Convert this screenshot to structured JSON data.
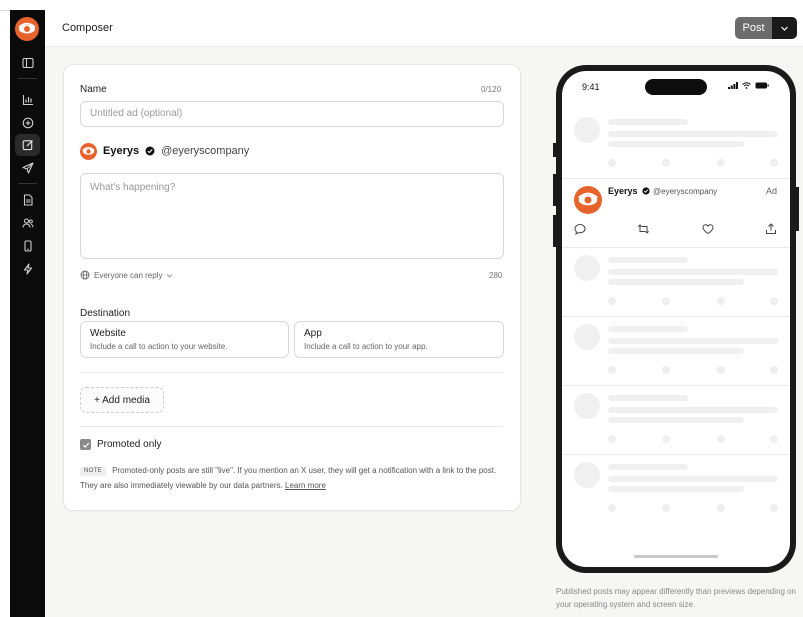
{
  "app": {
    "page_title": "Composer"
  },
  "toolbar": {
    "post_label": "Post"
  },
  "form": {
    "name_label": "Name",
    "name_counter": "0/120",
    "name_placeholder": "Untitled ad (optional)",
    "account_name": "Eyerys",
    "account_handle": "@eyeryscompany",
    "tweet_placeholder": "What's happening?",
    "reply_setting": "Everyone can reply",
    "char_remaining": "280",
    "destination_label": "Destination",
    "destinations": [
      {
        "title": "Website",
        "subtitle": "Include a call to action to your website."
      },
      {
        "title": "App",
        "subtitle": "Include a call to action to your app."
      }
    ],
    "add_media_label": "+ Add media",
    "promoted_only_label": "Promoted only",
    "promoted_only_checked": true,
    "note_badge": "NOTE",
    "note_text": "Promoted-only posts are still \"live\". If you mention an X user, they will get a notification with a link to the post. They are also immediately viewable by our data partners.",
    "note_link": "Learn more"
  },
  "preview": {
    "time": "9:41",
    "tweet_name": "Eyerys",
    "tweet_handle": "@eyeryscompany",
    "ad_label": "Ad",
    "disclaimer": "Published posts may appear differently than previews depending on your operating system and screen size."
  },
  "colors": {
    "brand": "#e8632b",
    "rail": "#0b0b0b",
    "post_button": "#6b6b6b"
  },
  "icons": {
    "rail": [
      "eyerys-logo",
      "sidebar-toggle-icon",
      "analytics-icon",
      "add-circle-icon",
      "compose-icon",
      "send-icon",
      "document-icon",
      "audience-icon",
      "mobile-icon",
      "lightning-icon"
    ]
  }
}
